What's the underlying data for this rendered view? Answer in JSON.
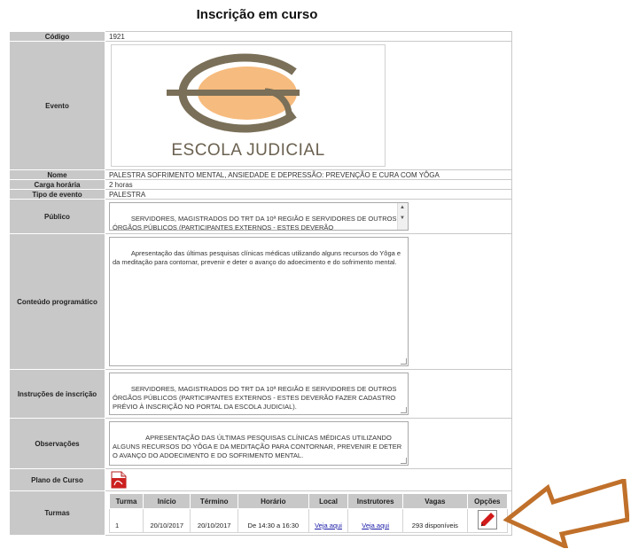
{
  "page": {
    "title": "Inscrição em curso"
  },
  "labels": {
    "codigo": "Código",
    "evento": "Evento",
    "nome": "Nome",
    "carga": "Carga horária",
    "tipo": "Tipo de evento",
    "publico": "Público",
    "conteudo": "Conteúdo programático",
    "instrucoes": "Instruções de inscrição",
    "observacoes": "Observações",
    "plano": "Plano de Curso",
    "turmas": "Turmas"
  },
  "values": {
    "codigo": "1921",
    "logo_text": "ESCOLA JUDICIAL",
    "nome": "PALESTRA SOFRIMENTO MENTAL, ANSIEDADE E DEPRESSÃO: PREVENÇÃO E CURA COM YÔGA",
    "carga": "2 horas",
    "tipo": "PALESTRA",
    "publico": "SERVIDORES, MAGISTRADOS DO TRT DA 10ª REGIÃO E SERVIDORES DE OUTROS ÓRGÃOS PÚBLICOS (PARTICIPANTES EXTERNOS - ESTES DEVERÃO",
    "conteudo": "Apresentação das últimas pesquisas clínicas médicas utilizando alguns recursos do Yôga e da meditação para contornar, prevenir e deter o avanço do adoecimento e do sofrimento mental.",
    "instrucoes": "SERVIDORES, MAGISTRADOS DO TRT DA 10ª REGIÃO E SERVIDORES DE OUTROS ÓRGÃOS PÚBLICOS (PARTICIPANTES EXTERNOS - ESTES DEVERÃO FAZER CADASTRO PRÉVIO À INSCRIÇÃO NO PORTAL DA ESCOLA JUDICIAL).",
    "observacoes": "        APRESENTAÇÃO DAS ÚLTIMAS PESQUISAS CLÍNICAS MÉDICAS UTILIZANDO ALGUNS RECURSOS DO YÔGA E DA MEDITAÇÃO PARA CONTORNAR, PREVENIR E DETER O AVANÇO DO ADOECIMENTO E DO SOFRIMENTO MENTAL."
  },
  "turmas": {
    "headers": [
      "Turma",
      "Início",
      "Término",
      "Horário",
      "Local",
      "Instrutores",
      "Vagas",
      "Opções"
    ],
    "rows": [
      {
        "turma": "1",
        "inicio": "20/10/2017",
        "termino": "20/10/2017",
        "horario": "De 14:30 a 16:30",
        "local": "Veja aqui",
        "instrutores": "Veja aqui",
        "vagas": "293 disponíveis"
      }
    ]
  },
  "icons": {
    "pdf": "pdf-icon",
    "edit": "pencil-edit-icon",
    "arrow": "arrow-left-icon"
  },
  "colors": {
    "label_bg": "#c8c8c8",
    "logo_ring": "#7a6f58",
    "logo_fill": "#f6bb7e",
    "arrow": "#c0702a",
    "pencil": "#d11a1a"
  }
}
